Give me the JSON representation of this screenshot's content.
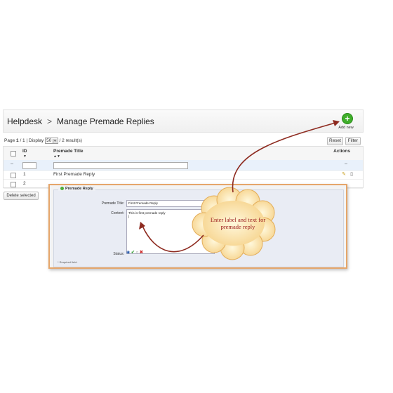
{
  "breadcrumb": {
    "root": "Helpdesk",
    "separator": ">",
    "current": "Manage Premade Replies"
  },
  "add_new_label": "Add new",
  "pager": {
    "page_prefix": "Page",
    "page_current": "1",
    "page_text": "/ 1 | Display",
    "per_page": "50",
    "results": "/ 2 result(s)"
  },
  "toolbar": {
    "reset": "Reset",
    "filter": "Filter"
  },
  "grid": {
    "headers": {
      "id": "ID",
      "title": "Premade Title",
      "actions": "Actions"
    },
    "filter_dash": "--",
    "actions_dash": "--",
    "rows": [
      {
        "id": "1",
        "title": "First Premade Reply"
      },
      {
        "id": "2",
        "title": ""
      }
    ]
  },
  "delete_selected": "Delete selected",
  "form": {
    "legend": "Premade Reply",
    "title_label": "Premade Title:",
    "title_value": "First Premade Reply",
    "content_label": "Content:",
    "content_value": "This is first premade reply",
    "status_label": "Status:",
    "required_note": "* Required field."
  },
  "callout": "Enter label and text for premade reply",
  "colors": {
    "accent_border": "#e6a66a",
    "callout_text": "#9a1b1b",
    "arrow": "#8e2b20",
    "add_icon": "#3fae2a"
  }
}
